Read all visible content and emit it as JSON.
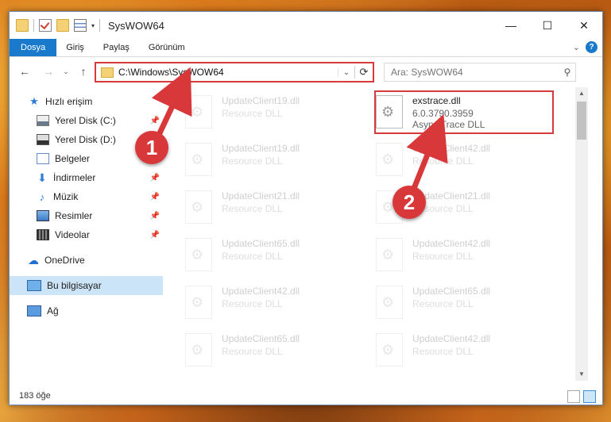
{
  "window": {
    "title": "SysWOW64",
    "controls": {
      "minimize": "—",
      "maximize": "☐",
      "close": "✕"
    }
  },
  "ribbon": {
    "tabs": [
      "Dosya",
      "Giriş",
      "Paylaş",
      "Görünüm"
    ],
    "expand": "⌄",
    "help": "?"
  },
  "nav": {
    "back": "←",
    "forward": "→",
    "recent": "⌄",
    "up": "↑",
    "address": "C:\\Windows\\SysWOW64",
    "address_dropdown": "⌄",
    "refresh": "⟳",
    "search_placeholder": "Ara: SysWOW64",
    "search_icon": "⚲"
  },
  "sidebar": {
    "items": [
      {
        "label": "Hızlı erişim",
        "icon": "star-icon"
      },
      {
        "label": "Yerel Disk (C:)",
        "icon": "disk-icon",
        "pinned": true
      },
      {
        "label": "Yerel Disk (D:)",
        "icon": "disk-icon",
        "pinned": true
      },
      {
        "label": "Belgeler",
        "icon": "documents-icon",
        "pinned": true
      },
      {
        "label": "İndirmeler",
        "icon": "download-icon",
        "pinned": true
      },
      {
        "label": "Müzik",
        "icon": "music-icon",
        "pinned": true
      },
      {
        "label": "Resimler",
        "icon": "pictures-icon",
        "pinned": true
      },
      {
        "label": "Videolar",
        "icon": "videos-icon",
        "pinned": true
      },
      {
        "label": "OneDrive",
        "icon": "cloud-icon"
      },
      {
        "label": "Bu bilgisayar",
        "icon": "computer-icon",
        "selected": true
      },
      {
        "label": "Ağ",
        "icon": "network-icon"
      }
    ]
  },
  "files": {
    "left_column": [
      {
        "name": "UpdateClient19.dll",
        "type": "Resource DLL"
      },
      {
        "name": "UpdateClient19.dll",
        "type": "Resource DLL"
      },
      {
        "name": "UpdateClient21.dll",
        "type": "Resource DLL"
      },
      {
        "name": "UpdateClient65.dll",
        "type": "Resource DLL"
      },
      {
        "name": "UpdateClient42.dll",
        "type": "Resource DLL"
      },
      {
        "name": "UpdateClient65.dll",
        "type": "Resource DLL"
      }
    ],
    "right_column": [
      {
        "name": "exstrace.dll",
        "version": "6.0.3790.3959",
        "type": "Async Trace DLL"
      },
      {
        "name": "UpdateClient42.dll",
        "type": "Resource DLL"
      },
      {
        "name": "UpdateClient21.dll",
        "type": "Resource DLL"
      },
      {
        "name": "UpdateClient42.dll",
        "type": "Resource DLL"
      },
      {
        "name": "UpdateClient65.dll",
        "type": "Resource DLL"
      },
      {
        "name": "UpdateClient42.dll",
        "type": "Resource DLL"
      }
    ]
  },
  "status": {
    "item_count": "183 öğe"
  },
  "annotations": {
    "step1": "1",
    "step2": "2",
    "color": "#d9383b"
  }
}
